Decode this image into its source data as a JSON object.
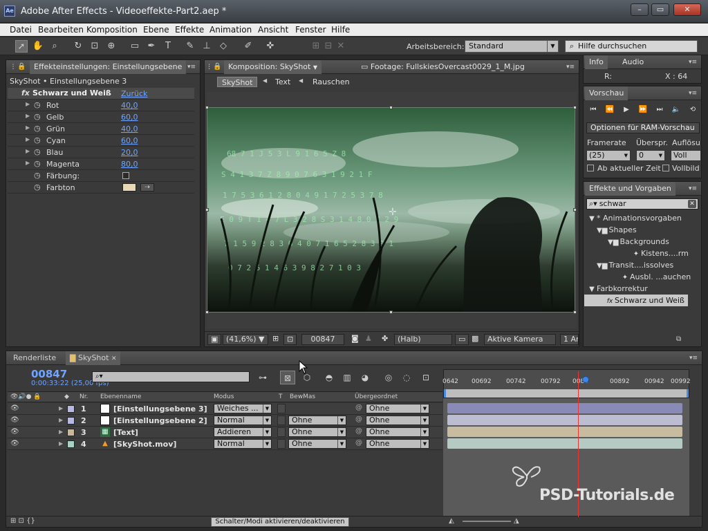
{
  "window": {
    "logo_text": "Ae",
    "title": "Adobe After Effects - Videoeffekte-Part2.aep *",
    "minimize": "–",
    "maximize": "▭",
    "close": "✕"
  },
  "menu": [
    "Datei",
    "Bearbeiten",
    "Komposition",
    "Ebene",
    "Effekte",
    "Animation",
    "Ansicht",
    "Fenster",
    "Hilfe"
  ],
  "toolbar": {
    "workspace_label": "Arbeitsbereich:",
    "workspace_value": "Standard",
    "help_search_placeholder": "Hilfe durchsuchen"
  },
  "effect_controls": {
    "tab_label": "Effekteinstellungen: Einstellungsebene",
    "breadcrumb": "SkyShot • Einstellungsebene 3",
    "effect_icon": "fx",
    "effect_name": "Schwarz und Weiß",
    "reset_label": "Zurück",
    "params": [
      {
        "label": "Rot",
        "value": "40,0"
      },
      {
        "label": "Gelb",
        "value": "60,0"
      },
      {
        "label": "Grün",
        "value": "40,0"
      },
      {
        "label": "Cyan",
        "value": "60,0"
      },
      {
        "label": "Blau",
        "value": "20,0"
      },
      {
        "label": "Magenta",
        "value": "80,0"
      }
    ],
    "tint_label": "Färbung:",
    "tint_color_label": "Farbton",
    "tint_color": "#e8d9b6"
  },
  "composition": {
    "tab_label": "Komposition: SkyShot",
    "footage_tab_label": "Footage: FullskiesOvercast0029_1_M.jpg",
    "nav": [
      "SkyShot",
      "Text",
      "Rauschen"
    ],
    "zoom": "(41,6%)",
    "timecode": "00847",
    "resolution": "(Halb)",
    "camera": "Aktive Kamera",
    "views": "1 An"
  },
  "info_panel": {
    "tabs": [
      "Info",
      "Audio"
    ],
    "r_label": "R:",
    "x_readout": "X : 64"
  },
  "preview_panel": {
    "tab": "Vorschau",
    "ram_options": "Optionen für RAM-Vorschau",
    "framerate_label": "Framerate",
    "skip_label": "Überspr.",
    "resolution_label": "Auflösu",
    "framerate_value": "(25)",
    "skip_value": "0",
    "resolution_value": "Voll",
    "from_current": "Ab aktueller Zeit",
    "fullscreen": "Vollbild"
  },
  "effects_presets": {
    "tab": "Effekte und Vorgaben",
    "search_value": "schwar",
    "tree": [
      {
        "label": "* Animationsvorgaben",
        "icon": "▼",
        "indent": 0
      },
      {
        "label": "Shapes",
        "icon": "▼",
        "indent": 1
      },
      {
        "label": "Backgrounds",
        "icon": "▼",
        "indent": 2
      },
      {
        "label": "Kistens....rm",
        "icon": "✦",
        "indent": 3
      },
      {
        "label": "Transit....issolves",
        "icon": "▼",
        "indent": 1
      },
      {
        "label": "Ausbl. ...auchen",
        "icon": "✦",
        "indent": 2
      },
      {
        "label": "Farbkorrektur",
        "icon": "▼",
        "indent": 0
      },
      {
        "label": "Schwarz und Weiß",
        "icon": "fx",
        "indent": 1,
        "selected": true
      }
    ]
  },
  "timeline": {
    "tabs": [
      "Renderliste",
      "SkyShot"
    ],
    "timecode": "00847",
    "subtime": "0:00:33:22 (25,00 fps)",
    "search_placeholder": "⌕▾",
    "ruler_ticks": [
      "0642",
      "00692",
      "00742",
      "00792",
      "0084",
      "00892",
      "00942",
      "00992"
    ],
    "columns": {
      "nr": "Nr.",
      "name": "Ebenenname",
      "mode": "Modus",
      "t": "T",
      "trkmat": "BewMas",
      "parent": "Übergeordnet"
    },
    "layers": [
      {
        "nr": "1",
        "name": "[Einstellungsebene 3]",
        "mode": "Weiches ...",
        "trkmat": "",
        "parent": "Ohne",
        "label_color": "#b8b8e0",
        "bar_color": "#8a8ab8",
        "type_icon": "□"
      },
      {
        "nr": "2",
        "name": "[Einstellungsebene 2]",
        "mode": "Normal",
        "trkmat": "Ohne",
        "parent": "Ohne",
        "label_color": "#b8b8e0",
        "bar_color": "#bdbdd2",
        "type_icon": "□"
      },
      {
        "nr": "3",
        "name": "[Text]",
        "mode": "Addieren",
        "trkmat": "Ohne",
        "parent": "Ohne",
        "label_color": "#c9b79a",
        "bar_color": "#c8bca0",
        "type_icon": "▦"
      },
      {
        "nr": "4",
        "name": "[SkyShot.mov]",
        "mode": "Normal",
        "trkmat": "Ohne",
        "parent": "Ohne",
        "label_color": "#a8d0c4",
        "bar_color": "#b6cac4",
        "type_icon": "▲"
      }
    ],
    "switch_modes": "Schalter/Modi aktivieren/deaktivieren"
  },
  "watermark": "PSD-Tutorials.de"
}
